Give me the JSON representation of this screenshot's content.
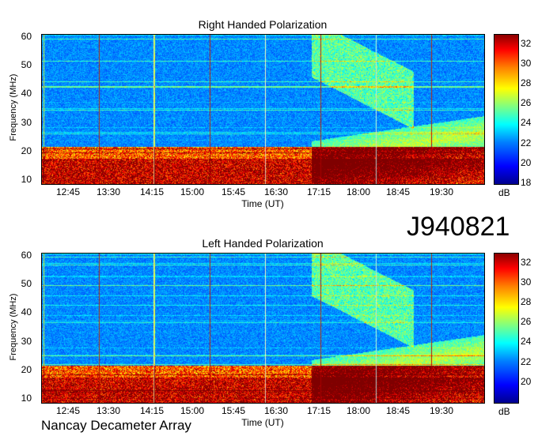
{
  "id_label": "J940821",
  "footer": "Nancay Decameter Array",
  "colorbar_unit": "dB",
  "chart_data": [
    {
      "type": "heatmap",
      "title": "Right Handed Polarization",
      "xlabel": "Time (UT)",
      "ylabel": "Frequency (MHz)",
      "yticks": [
        10,
        20,
        30,
        40,
        50,
        60
      ],
      "ylim": [
        9,
        61
      ],
      "xticks": [
        "12:45",
        "13:30",
        "14:15",
        "15:00",
        "15:45",
        "16:30",
        "17:15",
        "18:00",
        "18:45",
        "19:30"
      ],
      "colorbar": {
        "label": "dB",
        "ticks": [
          18,
          20,
          22,
          24,
          26,
          28,
          30,
          32
        ],
        "range": [
          18,
          33
        ]
      }
    },
    {
      "type": "heatmap",
      "title": "Left Handed Polarization",
      "xlabel": "Time (UT)",
      "ylabel": "Frequency (MHz)",
      "yticks": [
        10,
        20,
        30,
        40,
        50,
        60
      ],
      "ylim": [
        9,
        61
      ],
      "xticks": [
        "12:45",
        "13:30",
        "14:15",
        "15:00",
        "15:45",
        "16:30",
        "17:15",
        "18:00",
        "18:45",
        "19:30"
      ],
      "colorbar": {
        "label": "dB",
        "ticks": [
          20,
          22,
          24,
          26,
          28,
          30,
          32
        ],
        "range": [
          18,
          33
        ]
      }
    }
  ]
}
